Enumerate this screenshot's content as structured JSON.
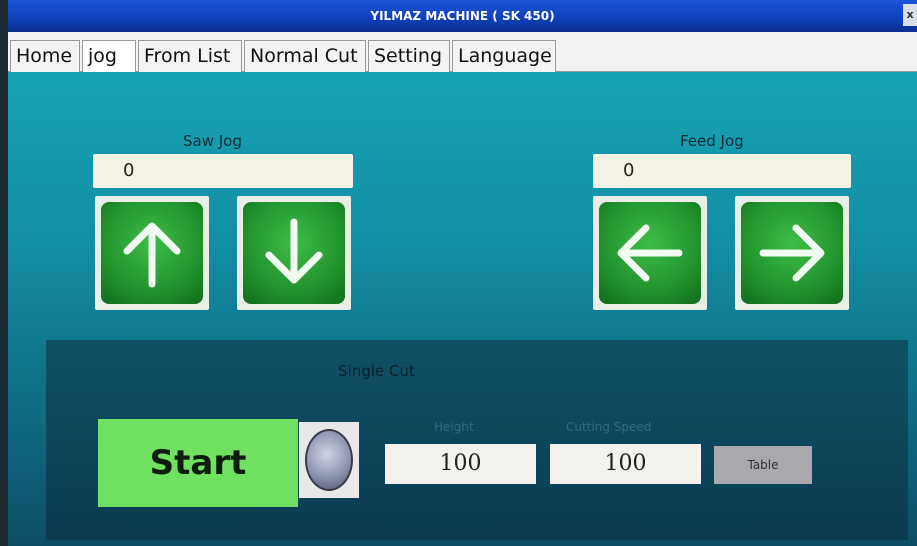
{
  "window": {
    "title": "YILMAZ MACHINE ( SK 450)",
    "close_label": "x"
  },
  "tabs": [
    {
      "label": "Home"
    },
    {
      "label": "jog"
    },
    {
      "label": "From List"
    },
    {
      "label": "Normal Cut"
    },
    {
      "label": "Setting"
    },
    {
      "label": "Language"
    }
  ],
  "active_tab": "jog",
  "saw_jog": {
    "label": "Saw Jog",
    "value": "0",
    "buttons": [
      {
        "icon": "arrow-up-icon"
      },
      {
        "icon": "arrow-down-icon"
      }
    ]
  },
  "feed_jog": {
    "label": "Feed Jog",
    "value": "0",
    "buttons": [
      {
        "icon": "arrow-left-icon"
      },
      {
        "icon": "arrow-right-icon"
      }
    ]
  },
  "single_cut": {
    "title": "Single Cut",
    "start_label": "Start",
    "height_label": "Height",
    "height_value": "100",
    "speed_label": "Cutting Speed",
    "speed_value": "100",
    "table_label": "Table"
  },
  "colors": {
    "jog_button": "#1f8f2b",
    "start_button": "#6fe05f",
    "title_bar": "#1d54d9"
  }
}
